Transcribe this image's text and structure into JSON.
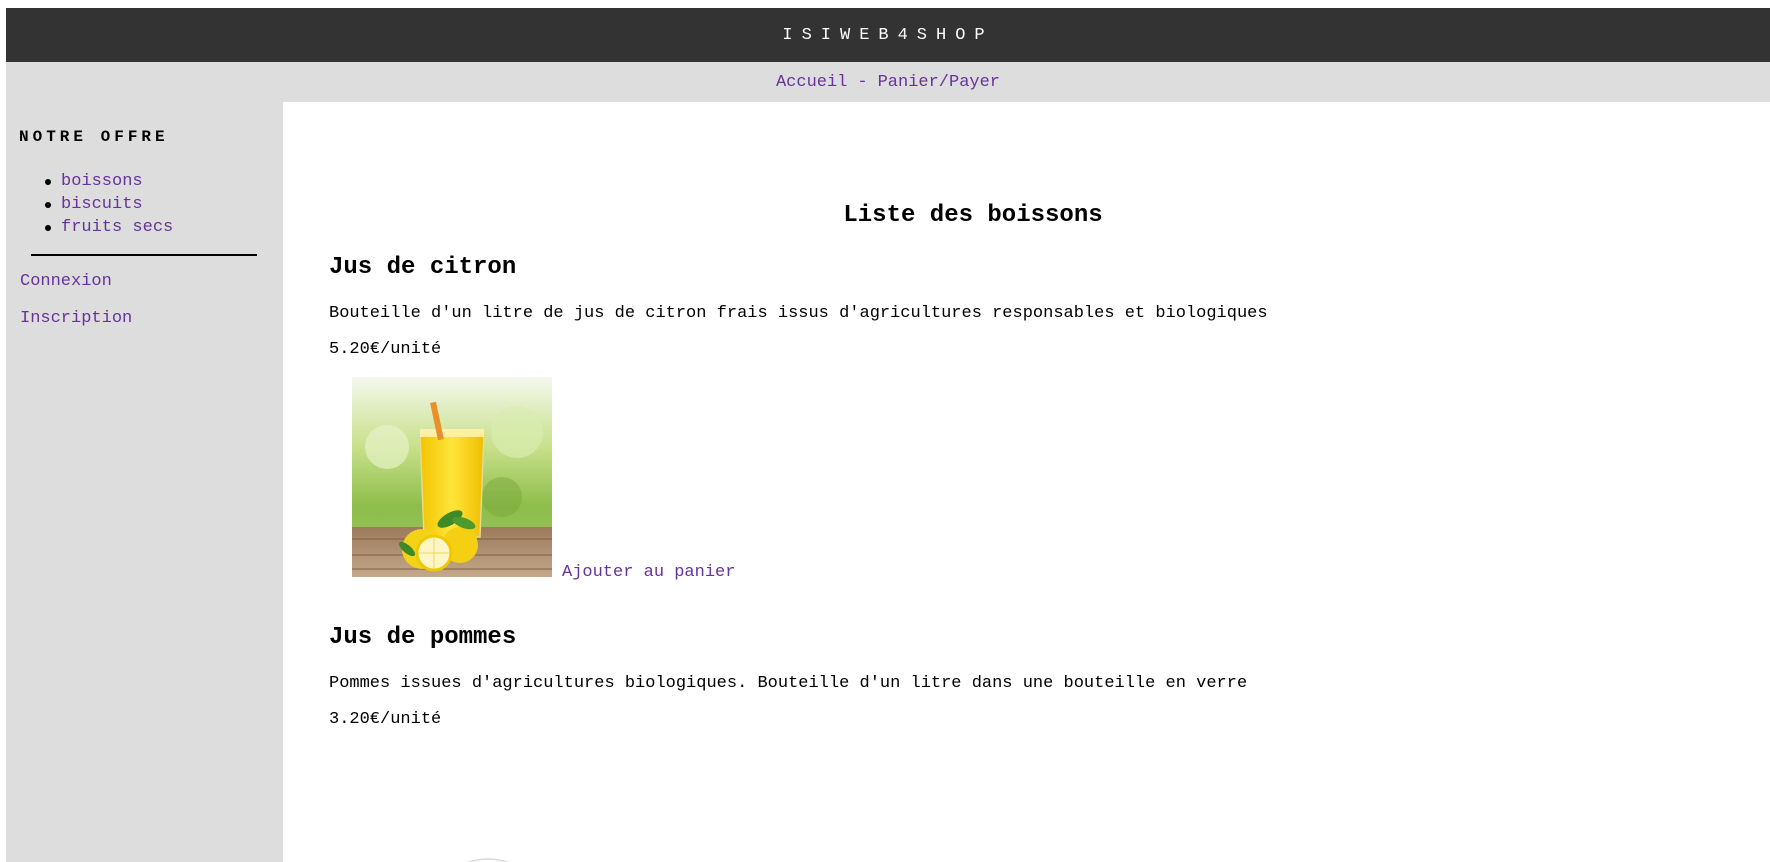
{
  "header": {
    "site_title": "ISIWEB4SHOP"
  },
  "topnav": {
    "home": "Accueil",
    "separator": "-",
    "cart": "Panier/Payer"
  },
  "sidebar": {
    "title": "NOTRE OFFRE",
    "categories": [
      {
        "label": "boissons"
      },
      {
        "label": "biscuits"
      },
      {
        "label": "fruits secs"
      }
    ],
    "login": "Connexion",
    "register": "Inscription"
  },
  "main": {
    "title": "Liste des boissons",
    "products": [
      {
        "name": "Jus de citron",
        "description": "Bouteille d'un litre de jus de citron frais issus d'agricultures responsables et biologiques",
        "price": "5.20€/unité",
        "image": "lemon-juice-glass",
        "add_label": "Ajouter au panier"
      },
      {
        "name": "Jus de pommes",
        "description": "Pommes issues d'agricultures biologiques. Bouteille d'un litre dans une bouteille en verre",
        "price": "3.20€/unité",
        "image": "apple-juice-bottle"
      }
    ]
  },
  "colors": {
    "banner": "#333333",
    "nav_bg": "#dddddd",
    "link": "#663399"
  }
}
